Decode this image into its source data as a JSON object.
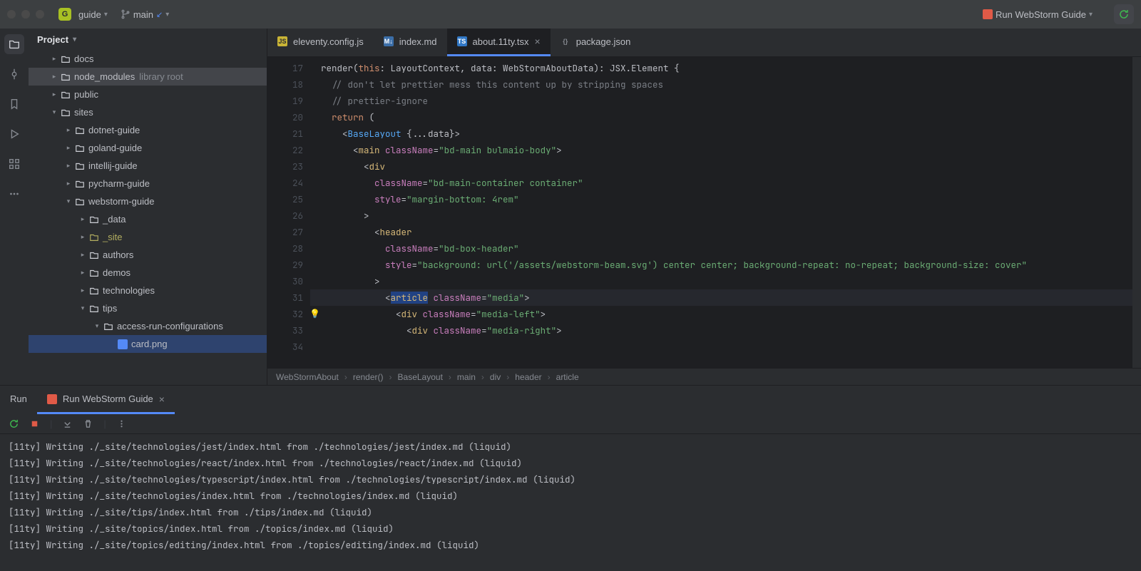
{
  "titlebar": {
    "project": "guide",
    "project_badge": "G",
    "branch": "main",
    "runConfig": "Run WebStorm Guide"
  },
  "sidebar": {
    "header": "Project",
    "tree": [
      {
        "d": 1,
        "ex": false,
        "icon": "folder",
        "label": "docs"
      },
      {
        "d": 1,
        "ex": false,
        "icon": "folder",
        "label": "node_modules",
        "dim": "library root",
        "sel": "dark"
      },
      {
        "d": 1,
        "ex": false,
        "icon": "folder",
        "label": "public"
      },
      {
        "d": 1,
        "ex": true,
        "icon": "folder",
        "label": "sites"
      },
      {
        "d": 2,
        "ex": false,
        "icon": "folder",
        "label": "dotnet-guide"
      },
      {
        "d": 2,
        "ex": false,
        "icon": "folder",
        "label": "goland-guide"
      },
      {
        "d": 2,
        "ex": false,
        "icon": "folder",
        "label": "intellij-guide"
      },
      {
        "d": 2,
        "ex": false,
        "icon": "folder",
        "label": "pycharm-guide"
      },
      {
        "d": 2,
        "ex": true,
        "icon": "folder",
        "label": "webstorm-guide"
      },
      {
        "d": 3,
        "ex": false,
        "icon": "folder",
        "label": "_data"
      },
      {
        "d": 3,
        "ex": false,
        "icon": "folder-c",
        "label": "_site"
      },
      {
        "d": 3,
        "ex": false,
        "icon": "folder",
        "label": "authors"
      },
      {
        "d": 3,
        "ex": false,
        "icon": "folder",
        "label": "demos"
      },
      {
        "d": 3,
        "ex": false,
        "icon": "folder",
        "label": "technologies"
      },
      {
        "d": 3,
        "ex": true,
        "icon": "folder",
        "label": "tips"
      },
      {
        "d": 4,
        "ex": true,
        "icon": "folder",
        "label": "access-run-configurations"
      },
      {
        "d": 5,
        "ex": null,
        "icon": "png",
        "label": "card.png",
        "sel": "blue"
      }
    ]
  },
  "tabs": [
    {
      "icon": "js",
      "label": "eleventy.config.js",
      "active": false,
      "close": false
    },
    {
      "icon": "md",
      "label": "index.md",
      "active": false,
      "close": false
    },
    {
      "icon": "tsx",
      "label": "about.11ty.tsx",
      "active": true,
      "close": true
    },
    {
      "icon": "json",
      "label": "package.json",
      "active": false,
      "close": false
    }
  ],
  "gutter": [
    {
      "n": 17
    },
    {
      "n": 18
    },
    {
      "n": 19
    },
    {
      "n": 20
    },
    {
      "n": 21
    },
    {
      "n": 22
    },
    {
      "n": 23
    },
    {
      "n": 24
    },
    {
      "n": 25
    },
    {
      "n": 26,
      "mod": true
    },
    {
      "n": 27
    },
    {
      "n": 28
    },
    {
      "n": 29,
      "mod": true
    },
    {
      "n": 30
    },
    {
      "n": 31
    },
    {
      "n": 32,
      "bulb": true
    },
    {
      "n": 33
    },
    {
      "n": 34
    }
  ],
  "code": {
    "l17": "",
    "l18_a": "  render(",
    "l18_b": "this",
    "l18_c": ": LayoutContext, data: WebStormAboutData): JSX.Element {",
    "l19": "    // don't let prettier mess this content up by stripping spaces",
    "l20": "    // prettier-ignore",
    "l21_a": "    ",
    "l21_b": "return",
    "l21_c": " (",
    "l22_a": "      <",
    "l22_b": "BaseLayout",
    "l22_c": " {...data}>",
    "l23_a": "        <",
    "l23_b": "main",
    "l23_c": " ",
    "l23_d": "className",
    "l23_e": "=",
    "l23_f": "\"bd-main bulmaio-body\"",
    "l23_g": ">",
    "l24_a": "          <",
    "l24_b": "div",
    "l25_a": "            ",
    "l25_b": "className",
    "l25_c": "=",
    "l25_d": "\"bd-main-container container\"",
    "l26_a": "            ",
    "l26_b": "style",
    "l26_c": "=",
    "l26_d": "\"margin-bottom: 4rem\"",
    "l27": "          >",
    "l28_a": "            <",
    "l28_b": "header",
    "l29_a": "              ",
    "l29_b": "className",
    "l29_c": "=",
    "l29_d": "\"bd-box-header\"",
    "l30_a": "              ",
    "l30_b": "style",
    "l30_c": "=",
    "l30_d": "\"background: url('/assets/webstorm-beam.svg') center center; background-repeat: no-repeat; background-size: cover\"",
    "l31": "            >",
    "l32_a": "              <",
    "l32_b": "article",
    "l32_c": " ",
    "l32_d": "className",
    "l32_e": "=",
    "l32_f": "\"media\"",
    "l32_g": ">",
    "l33_a": "                <",
    "l33_b": "div",
    "l33_c": " ",
    "l33_d": "className",
    "l33_e": "=",
    "l33_f": "\"media-left\"",
    "l33_g": ">",
    "l34_a": "                  <",
    "l34_b": "div",
    "l34_c": " ",
    "l34_d": "className",
    "l34_e": "=",
    "l34_f": "\"media-right\"",
    "l34_g": ">"
  },
  "breadcrumb": [
    "WebStormAbout",
    "render()",
    "BaseLayout",
    "main",
    "div",
    "header",
    "article"
  ],
  "bottomTabs": {
    "run": "Run",
    "config": "Run WebStorm Guide"
  },
  "console": [
    "[11ty] Writing ./_site/technologies/jest/index.html from ./technologies/jest/index.md (liquid)",
    "[11ty] Writing ./_site/technologies/react/index.html from ./technologies/react/index.md (liquid)",
    "[11ty] Writing ./_site/technologies/typescript/index.html from ./technologies/typescript/index.md (liquid)",
    "[11ty] Writing ./_site/technologies/index.html from ./technologies/index.md (liquid)",
    "[11ty] Writing ./_site/tips/index.html from ./tips/index.md (liquid)",
    "[11ty] Writing ./_site/topics/index.html from ./topics/index.md (liquid)",
    "[11ty] Writing ./_site/topics/editing/index.html from ./topics/editing/index.md (liquid)"
  ]
}
